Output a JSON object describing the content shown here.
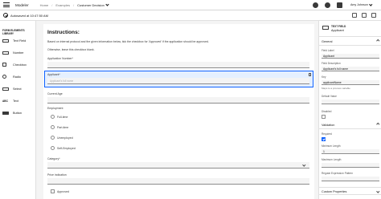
{
  "topbar": {
    "brand": "Modeler",
    "crumbs": [
      "Home",
      "Examples",
      "Customer Decision"
    ],
    "user": "Amy Johnson"
  },
  "subbar": {
    "autosave": "Autosaved at 10:47:50 AM"
  },
  "library": {
    "heading": "FORM ELEMENTS LIBRARY",
    "items": [
      {
        "label": "Text Field",
        "icon": "text-field-icon"
      },
      {
        "label": "Number",
        "icon": "number-icon"
      },
      {
        "label": "Checkbox",
        "icon": "checkbox-icon"
      },
      {
        "label": "Radio",
        "icon": "radio-icon"
      },
      {
        "label": "Select",
        "icon": "select-icon"
      },
      {
        "label": "Text",
        "icon": "text-icon",
        "glyph": "ABC"
      },
      {
        "label": "Button",
        "icon": "button-icon"
      }
    ]
  },
  "form": {
    "title": "Instructions:",
    "para1": "Based on internal protocol and the given information below, tick the checkbox for 'Approved' if the application should be approved.",
    "para2": "Otherwise, leave this checkbox blank.",
    "application_number_label": "Application Number*",
    "applicant_label": "Applicant*",
    "applicant_placeholder": "Applicant's full name",
    "current_age_label": "Current Age",
    "employment_label": "Employment",
    "employment_options": [
      "Full-time",
      "Part-time",
      "Unemployed",
      "Self-Employed"
    ],
    "category_label": "Category*",
    "price_indication_label": "Price indication",
    "approved_label": "Approved"
  },
  "props": {
    "type": "TEXT FIELD",
    "name": "Applicant",
    "general_title": "General",
    "field_label_label": "Field Label",
    "field_label_value": "Applicant",
    "field_description_label": "Field Description",
    "field_description_value": "Applicant's full name",
    "key_label": "Key",
    "key_value": "applicantName",
    "key_hint": "Maps to a process variable",
    "default_value_label": "Default Value",
    "disabled_label": "Disabled",
    "validation_title": "Validation",
    "required_label": "Required",
    "minimum_length_label": "Minimum Length",
    "minimum_length_value": "1",
    "maximum_length_label": "Maximum Length",
    "regex_label": "Regular Expression Pattern",
    "custom_props_title": "Custom Properties"
  }
}
